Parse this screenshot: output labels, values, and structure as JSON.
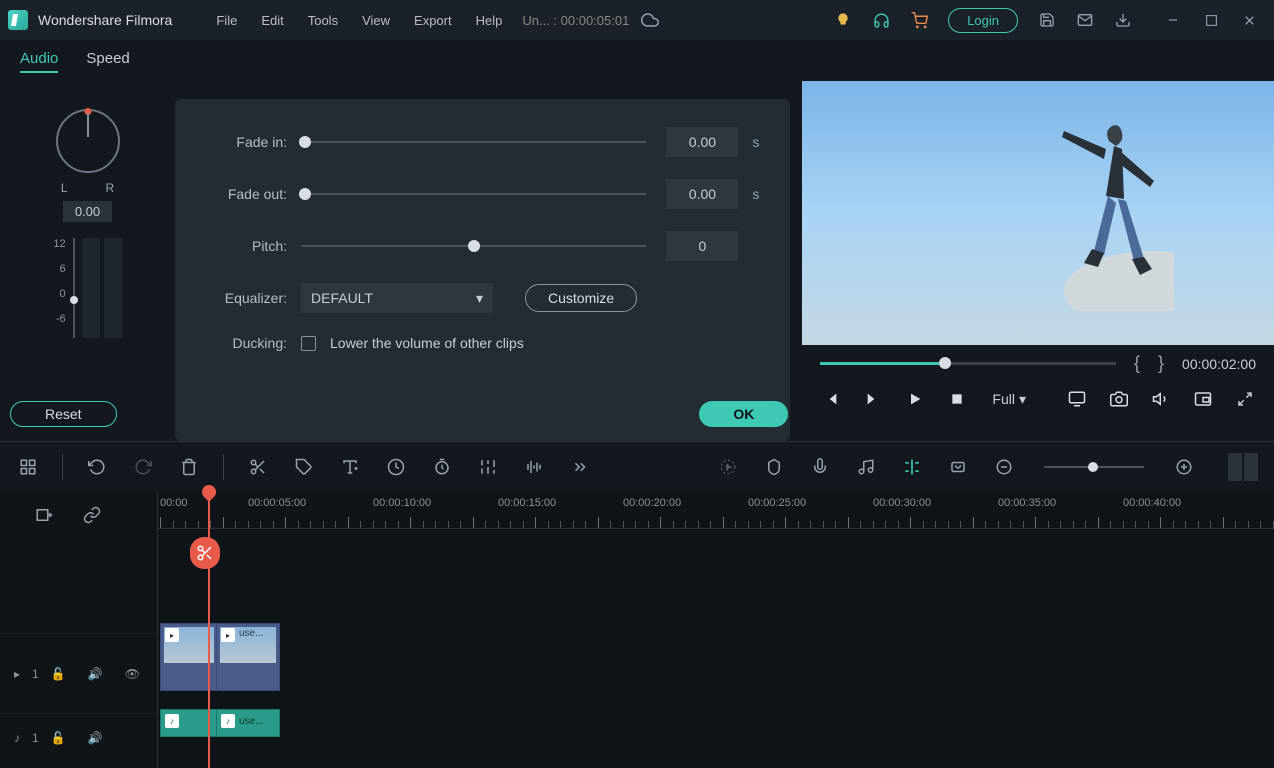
{
  "app": {
    "title": "Wondershare Filmora"
  },
  "menu": {
    "file": "File",
    "edit": "Edit",
    "tools": "Tools",
    "view": "View",
    "export": "Export",
    "help": "Help"
  },
  "status": "Un... : 00:00:05:01",
  "login": "Login",
  "tabs": {
    "audio": "Audio",
    "speed": "Speed"
  },
  "pan": {
    "l": "L",
    "r": "R",
    "value": "0.00"
  },
  "vu": {
    "p12": "12",
    "p6": "6",
    "p0": "0",
    "m6": "-6"
  },
  "audio": {
    "fadein_label": "Fade in:",
    "fadein_val": "0.00",
    "fadein_unit": "s",
    "fadeout_label": "Fade out:",
    "fadeout_val": "0.00",
    "fadeout_unit": "s",
    "pitch_label": "Pitch:",
    "pitch_val": "0",
    "eq_label": "Equalizer:",
    "eq_val": "DEFAULT",
    "customize": "Customize",
    "duck_label": "Ducking:",
    "duck_text": "Lower the volume of other clips"
  },
  "buttons": {
    "reset": "Reset",
    "ok": "OK"
  },
  "preview": {
    "timecode": "00:00:02:00",
    "quality": "Full"
  },
  "ruler": {
    "t0": "00:00",
    "t5": "00:00:05:00",
    "t10": "00:00:10:00",
    "t15": "00:00:15:00",
    "t20": "00:00:20:00",
    "t25": "00:00:25:00",
    "t30": "00:00:30:00",
    "t35": "00:00:35:00",
    "t40": "00:00:40:00"
  },
  "track": {
    "v1": "1",
    "a1": "1"
  },
  "clips": {
    "c2": "use...",
    "a2": "use..."
  }
}
